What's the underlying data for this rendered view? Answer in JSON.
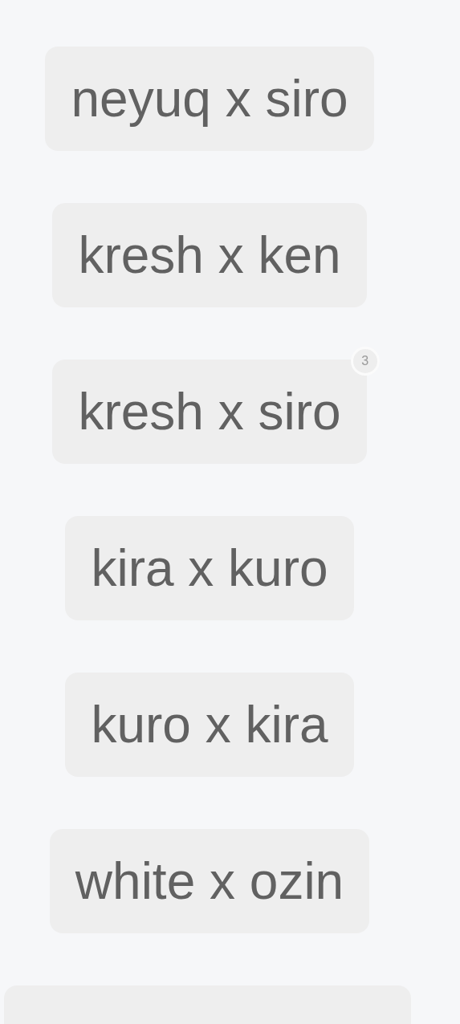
{
  "tags": [
    {
      "kind": "chip",
      "label": "neyuq x siro"
    },
    {
      "kind": "chip",
      "label": "kresh x ken"
    },
    {
      "kind": "chip",
      "label": "kresh x siro",
      "badge": "3"
    },
    {
      "kind": "chip",
      "label": "kira x kuro"
    },
    {
      "kind": "chip",
      "label": "kuro x kira"
    },
    {
      "kind": "chip",
      "label": "white x ozin"
    },
    {
      "kind": "cut"
    }
  ]
}
